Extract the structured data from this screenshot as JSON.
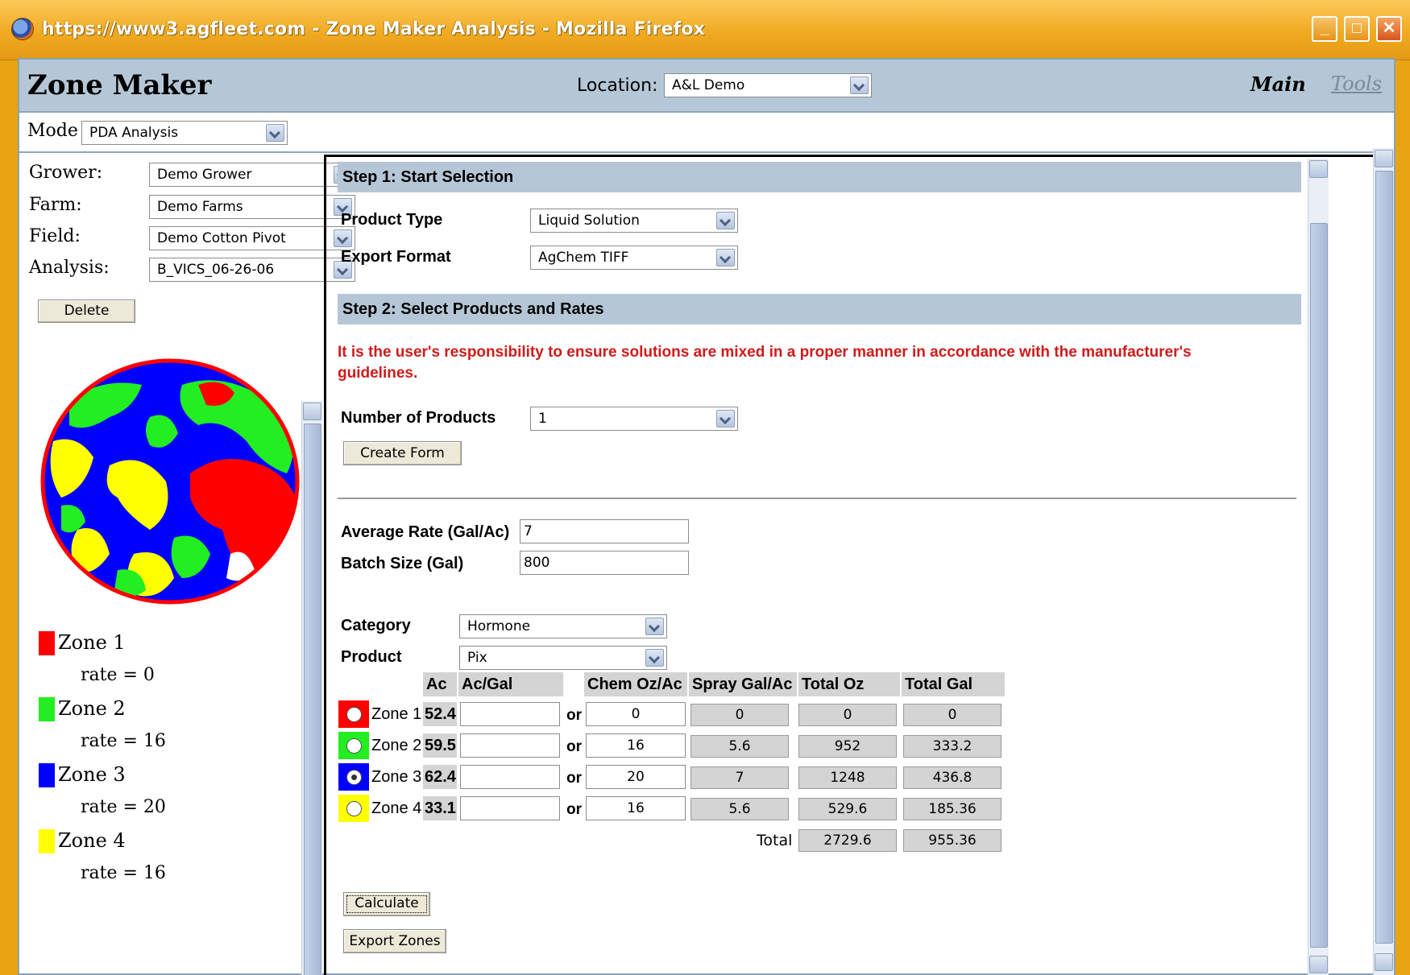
{
  "browser": {
    "title": "https://www3.agfleet.com - Zone Maker Analysis - Mozilla Firefox",
    "minimize": "_",
    "maximize": "□",
    "close": "✕"
  },
  "app": {
    "title": "Zone Maker",
    "location_label": "Location:",
    "location_value": "A&L Demo",
    "nav_main": "Main",
    "nav_tools": "Tools"
  },
  "mode": {
    "label": "Mode",
    "value": "PDA Analysis"
  },
  "left": {
    "grower_label": "Grower:",
    "grower_value": "Demo Grower",
    "farm_label": "Farm:",
    "farm_value": "Demo Farms",
    "field_label": "Field:",
    "field_value": "Demo Cotton Pivot",
    "analysis_label": "Analysis:",
    "analysis_value": "B_VICS_06-26-06",
    "delete_label": "Delete",
    "legend": [
      {
        "name": "Zone 1",
        "rate": "rate = 0",
        "color": "#ff0000"
      },
      {
        "name": "Zone 2",
        "rate": "rate = 16",
        "color": "#22ee22"
      },
      {
        "name": "Zone 3",
        "rate": "rate = 20",
        "color": "#0000ff"
      },
      {
        "name": "Zone 4",
        "rate": "rate = 16",
        "color": "#ffff00"
      }
    ]
  },
  "step1": {
    "header": "Step 1: Start Selection",
    "product_type_label": "Product Type",
    "product_type_value": "Liquid Solution",
    "export_format_label": "Export Format",
    "export_format_value": "AgChem TIFF"
  },
  "step2": {
    "header": "Step 2: Select Products and Rates",
    "warning": "It is the user's responsibility to ensure solutions are mixed in a proper manner in accordance with the manufacturer's guidelines.",
    "num_products_label": "Number of Products",
    "num_products_value": "1",
    "create_form_label": "Create Form",
    "avg_rate_label": "Average Rate (Gal/Ac)",
    "avg_rate_value": "7",
    "batch_size_label": "Batch Size (Gal)",
    "batch_size_value": "800",
    "category_label": "Category",
    "category_value": "Hormone",
    "product_label": "Product",
    "product_value": "Pix"
  },
  "table": {
    "headers": {
      "ac": "Ac",
      "acgal": "Ac/Gal",
      "chem": "Chem Oz/Ac",
      "spray": "Spray Gal/Ac",
      "totaloz": "Total Oz",
      "totalgal": "Total Gal"
    },
    "or": "or",
    "rows": [
      {
        "zone": "Zone 1",
        "ac": "52.4",
        "acgal": "",
        "chem": "0",
        "spray": "0",
        "totaloz": "0",
        "totalgal": "0",
        "color": "#ff0000"
      },
      {
        "zone": "Zone 2",
        "ac": "59.5",
        "acgal": "",
        "chem": "16",
        "spray": "5.6",
        "totaloz": "952",
        "totalgal": "333.2",
        "color": "#22ee22"
      },
      {
        "zone": "Zone 3",
        "ac": "62.4",
        "acgal": "",
        "chem": "20",
        "spray": "7",
        "totaloz": "1248",
        "totalgal": "436.8",
        "color": "#0000ff"
      },
      {
        "zone": "Zone 4",
        "ac": "33.1",
        "acgal": "",
        "chem": "16",
        "spray": "5.6",
        "totaloz": "529.6",
        "totalgal": "185.36",
        "color": "#ffff00"
      }
    ],
    "total_label": "Total",
    "total_oz": "2729.6",
    "total_gal": "955.36"
  },
  "buttons": {
    "calculate": "Calculate",
    "export_zones": "Export Zones"
  }
}
